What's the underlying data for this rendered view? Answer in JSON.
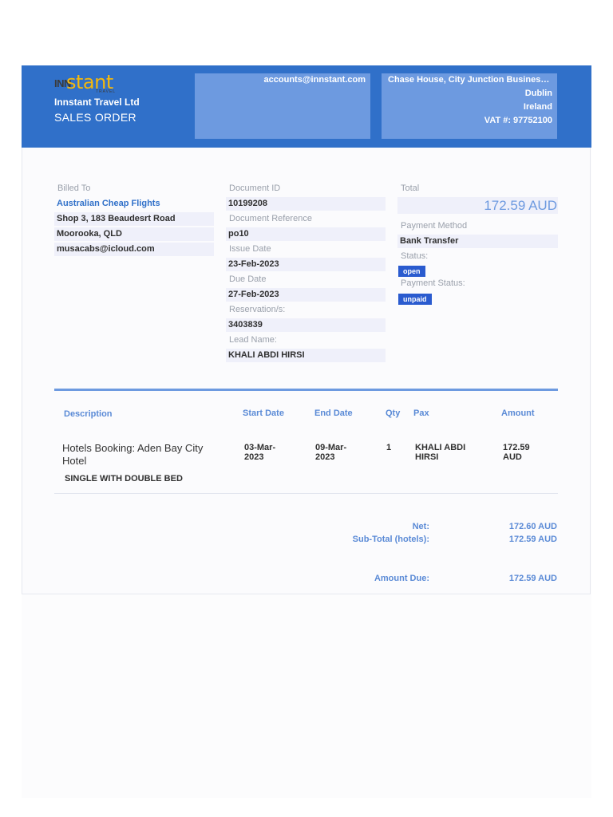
{
  "header": {
    "logo_ins": "INN",
    "logo_stant": "stant",
    "logo_travel": "TRAVEL",
    "company": "Innstant Travel Ltd",
    "doc_title": "SALES ORDER",
    "email": "accounts@innstant.com",
    "address_line1": "Chase House, City Junction Business Park",
    "address_city": "Dublin",
    "address_country": "Ireland",
    "vat": "VAT #: 97752100"
  },
  "billed_to": {
    "label": "Billed To",
    "name": "Australian Cheap Flights",
    "street": "Shop 3, 183 Beaudesrt Road",
    "city": "Moorooka, QLD",
    "email": "musacabs@icloud.com"
  },
  "document": {
    "id_label": "Document ID",
    "id": "10199208",
    "ref_label": "Document Reference",
    "ref": "po10",
    "issue_label": "Issue Date",
    "issue": "23-Feb-2023",
    "due_label": "Due Date",
    "due": "27-Feb-2023",
    "res_label": "Reservation/s:",
    "res": "3403839",
    "lead_label": "Lead Name:",
    "lead": "KHALI ABDI HIRSI"
  },
  "summary": {
    "total_label": "Total",
    "total": "172.59 AUD",
    "method_label": "Payment Method",
    "method": "Bank Transfer",
    "status_label": "Status:",
    "status": "open",
    "pay_status_label": "Payment Status:",
    "pay_status": "unpaid"
  },
  "table": {
    "headers": {
      "description": "Description",
      "start": "Start Date",
      "end": "End Date",
      "qty": "Qty",
      "pax": "Pax",
      "amount": "Amount"
    },
    "rows": [
      {
        "description": "Hotels Booking: Aden Bay City Hotel",
        "detail": "SINGLE WITH DOUBLE BED",
        "start": "03-Mar-2023",
        "end": "09-Mar-2023",
        "qty": "1",
        "pax": "KHALI ABDI HIRSI",
        "amount": "172.59 AUD"
      }
    ]
  },
  "totals": {
    "net_label": "Net:",
    "net": "172.60 AUD",
    "subtotal_label": "Sub-Total (hotels):",
    "subtotal": "172.59 AUD",
    "due_label": "Amount Due:",
    "due": "172.59 AUD"
  },
  "colors": {
    "header_blue": "#3070c9",
    "header_box": "#6d9ae0",
    "logo_yellow": "#f5b80c",
    "badge_blue": "#2a5bcf",
    "field_bg": "#eff0fa"
  }
}
